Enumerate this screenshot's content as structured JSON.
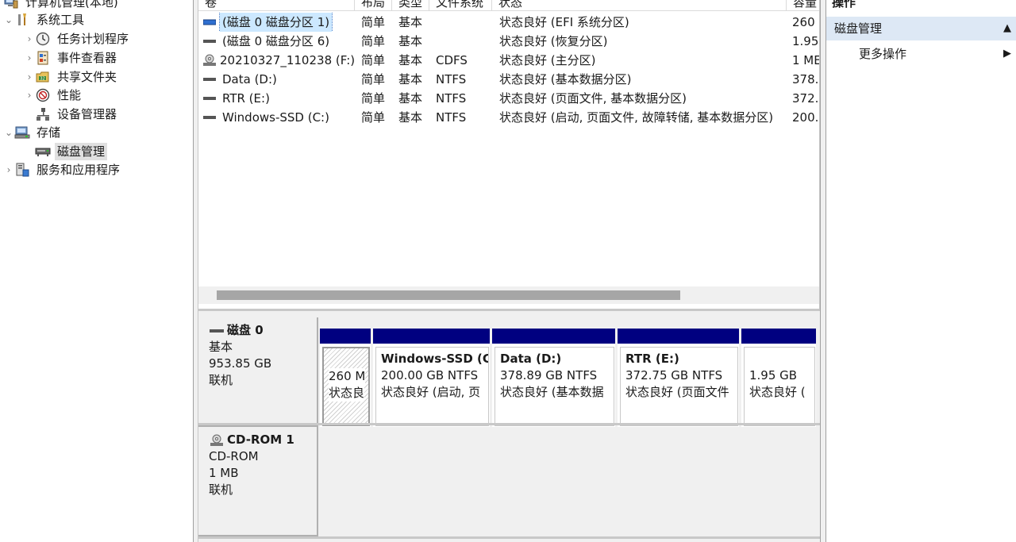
{
  "tree": {
    "root_label": "计算机管理(本地)",
    "items": [
      {
        "label": "系统工具",
        "expanded": true
      },
      {
        "label": "任务计划程序"
      },
      {
        "label": "事件查看器"
      },
      {
        "label": "共享文件夹"
      },
      {
        "label": "性能"
      },
      {
        "label": "设备管理器"
      },
      {
        "label": "存储",
        "expanded": true
      },
      {
        "label": "磁盘管理",
        "selected": true
      },
      {
        "label": "服务和应用程序"
      }
    ]
  },
  "volume_list": {
    "columns": [
      "卷",
      "布局",
      "类型",
      "文件系统",
      "状态",
      "容量"
    ],
    "rows": [
      {
        "name": "(磁盘 0 磁盘分区 1)",
        "layout": "简单",
        "type": "基本",
        "fs": "",
        "status": "状态良好 (EFI 系统分区)",
        "capacity": "260 I",
        "selected": true
      },
      {
        "name": "(磁盘 0 磁盘分区 6)",
        "layout": "简单",
        "type": "基本",
        "fs": "",
        "status": "状态良好 (恢复分区)",
        "capacity": "1.95"
      },
      {
        "name": "20210327_110238 (F:)",
        "layout": "简单",
        "type": "基本",
        "fs": "CDFS",
        "status": "状态良好 (主分区)",
        "capacity": "1 ME"
      },
      {
        "name": "Data (D:)",
        "layout": "简单",
        "type": "基本",
        "fs": "NTFS",
        "status": "状态良好 (基本数据分区)",
        "capacity": "378.8"
      },
      {
        "name": "RTR (E:)",
        "layout": "简单",
        "type": "基本",
        "fs": "NTFS",
        "status": "状态良好 (页面文件, 基本数据分区)",
        "capacity": "372.7"
      },
      {
        "name": "Windows-SSD (C:)",
        "layout": "简单",
        "type": "基本",
        "fs": "NTFS",
        "status": "状态良好 (启动, 页面文件, 故障转储, 基本数据分区)",
        "capacity": "200.0"
      }
    ]
  },
  "disks": [
    {
      "title": "磁盘 0",
      "kind": "基本",
      "size": "953.85 GB",
      "state": "联机",
      "partitions": [
        {
          "name": "",
          "line1": "260 M",
          "line2": "状态良",
          "hatched": true
        },
        {
          "name": "Windows-SSD (C:)",
          "line1": "200.00 GB NTFS",
          "line2": "状态良好 (启动, 页"
        },
        {
          "name": "Data (D:)",
          "line1": "378.89 GB NTFS",
          "line2": "状态良好 (基本数据"
        },
        {
          "name": "RTR (E:)",
          "line1": "372.75 GB NTFS",
          "line2": "状态良好 (页面文件"
        },
        {
          "name": "",
          "line1": "1.95 GB",
          "line2": "状态良好 ("
        }
      ]
    },
    {
      "title": "CD-ROM 1",
      "kind": "CD-ROM",
      "size": "1 MB",
      "state": "联机",
      "partitions": []
    }
  ],
  "actions": {
    "title": "操作",
    "group_label": "磁盘管理",
    "more_label": "更多操作"
  },
  "colors": {
    "partition_header": "#000080",
    "selection": "#cce8ff",
    "actions_group_bg": "#dde8f5"
  }
}
